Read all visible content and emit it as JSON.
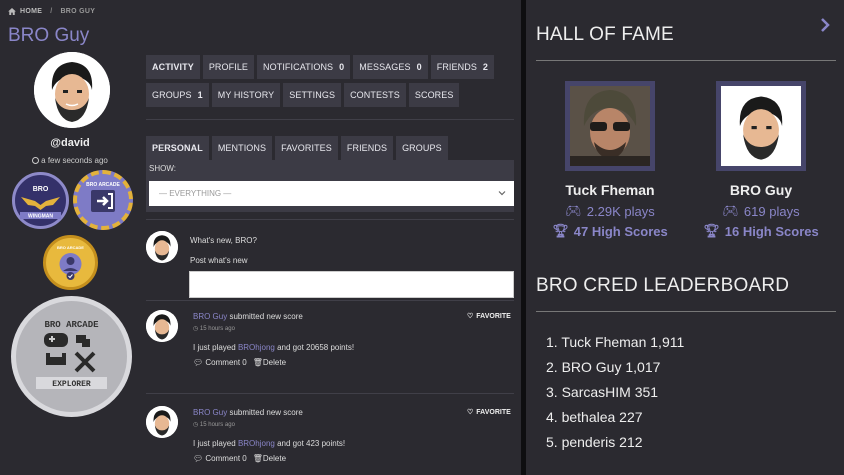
{
  "breadcrumb": {
    "home": "HOME",
    "separator": "/",
    "current": "BRO GUY"
  },
  "profile": {
    "title": "BRO Guy",
    "username": "@david",
    "last_active": "a few seconds ago",
    "badges": {
      "wingman": {
        "top": "BRO",
        "bottom": "WINGMAN"
      },
      "arcade": {
        "text": "BRO ARCADE"
      },
      "gold": {
        "text": "BRO ARCADE"
      },
      "explorer": {
        "top": "BRO ARCADE",
        "bottom": "EXPLORER"
      }
    }
  },
  "nav": {
    "row1": [
      {
        "label": "ACTIVITY",
        "count": ""
      },
      {
        "label": "PROFILE",
        "count": ""
      },
      {
        "label": "NOTIFICATIONS",
        "count": "0"
      },
      {
        "label": "MESSAGES",
        "count": "0"
      },
      {
        "label": "FRIENDS",
        "count": "2"
      }
    ],
    "row2": [
      {
        "label": "GROUPS",
        "count": "1"
      },
      {
        "label": "MY HISTORY",
        "count": ""
      },
      {
        "label": "SETTINGS",
        "count": ""
      },
      {
        "label": "CONTESTS",
        "count": ""
      },
      {
        "label": "SCORES",
        "count": ""
      }
    ]
  },
  "subnav": [
    "PERSONAL",
    "MENTIONS",
    "FAVORITES",
    "FRIENDS",
    "GROUPS"
  ],
  "filter": {
    "label": "SHOW:",
    "value": "— EVERYTHING —"
  },
  "whats_new": {
    "prompt": "What's new, BRO?",
    "label": "Post what's new",
    "placeholder": ""
  },
  "activities": [
    {
      "user": "BRO Guy",
      "action": "submitted new score",
      "time": "15 hours ago",
      "text_before": "I just played",
      "game": "BROhjong",
      "text_after": "and got 20658 points!",
      "comment": "Comment 0",
      "delete": "Delete",
      "favorite": "FAVORITE"
    },
    {
      "user": "BRO Guy",
      "action": "submitted new score",
      "time": "15 hours ago",
      "text_before": "I just played",
      "game": "BROhjong",
      "text_after": "and got 423 points!",
      "comment": "Comment 0",
      "delete": "Delete",
      "favorite": "FAVORITE"
    }
  ],
  "hall_of_fame": {
    "title": "HALL OF FAME",
    "entries": [
      {
        "name": "Tuck Fheman",
        "plays": "2.29K plays",
        "high_scores": "47 High Scores"
      },
      {
        "name": "BRO Guy",
        "plays": "619 plays",
        "high_scores": "16 High Scores"
      }
    ]
  },
  "leaderboard": {
    "title": "BRO CRED LEADERBOARD",
    "items": [
      "1. Tuck Fheman 1,911",
      "2. BRO Guy 1,017",
      "3. SarcasHIM 351",
      "4. bethalea 227",
      "5. penderis 212"
    ]
  },
  "colors": {
    "accent": "#8a86c8",
    "panel": "#2b2a30",
    "button": "#3c3b45",
    "gold": "#e8b93d"
  },
  "icons": [
    "home-icon",
    "clock-icon",
    "chevron-down-icon",
    "heart-icon",
    "comment-icon",
    "trash-icon",
    "gamepad-icon",
    "trophy-icon",
    "chevron-right-icon"
  ]
}
